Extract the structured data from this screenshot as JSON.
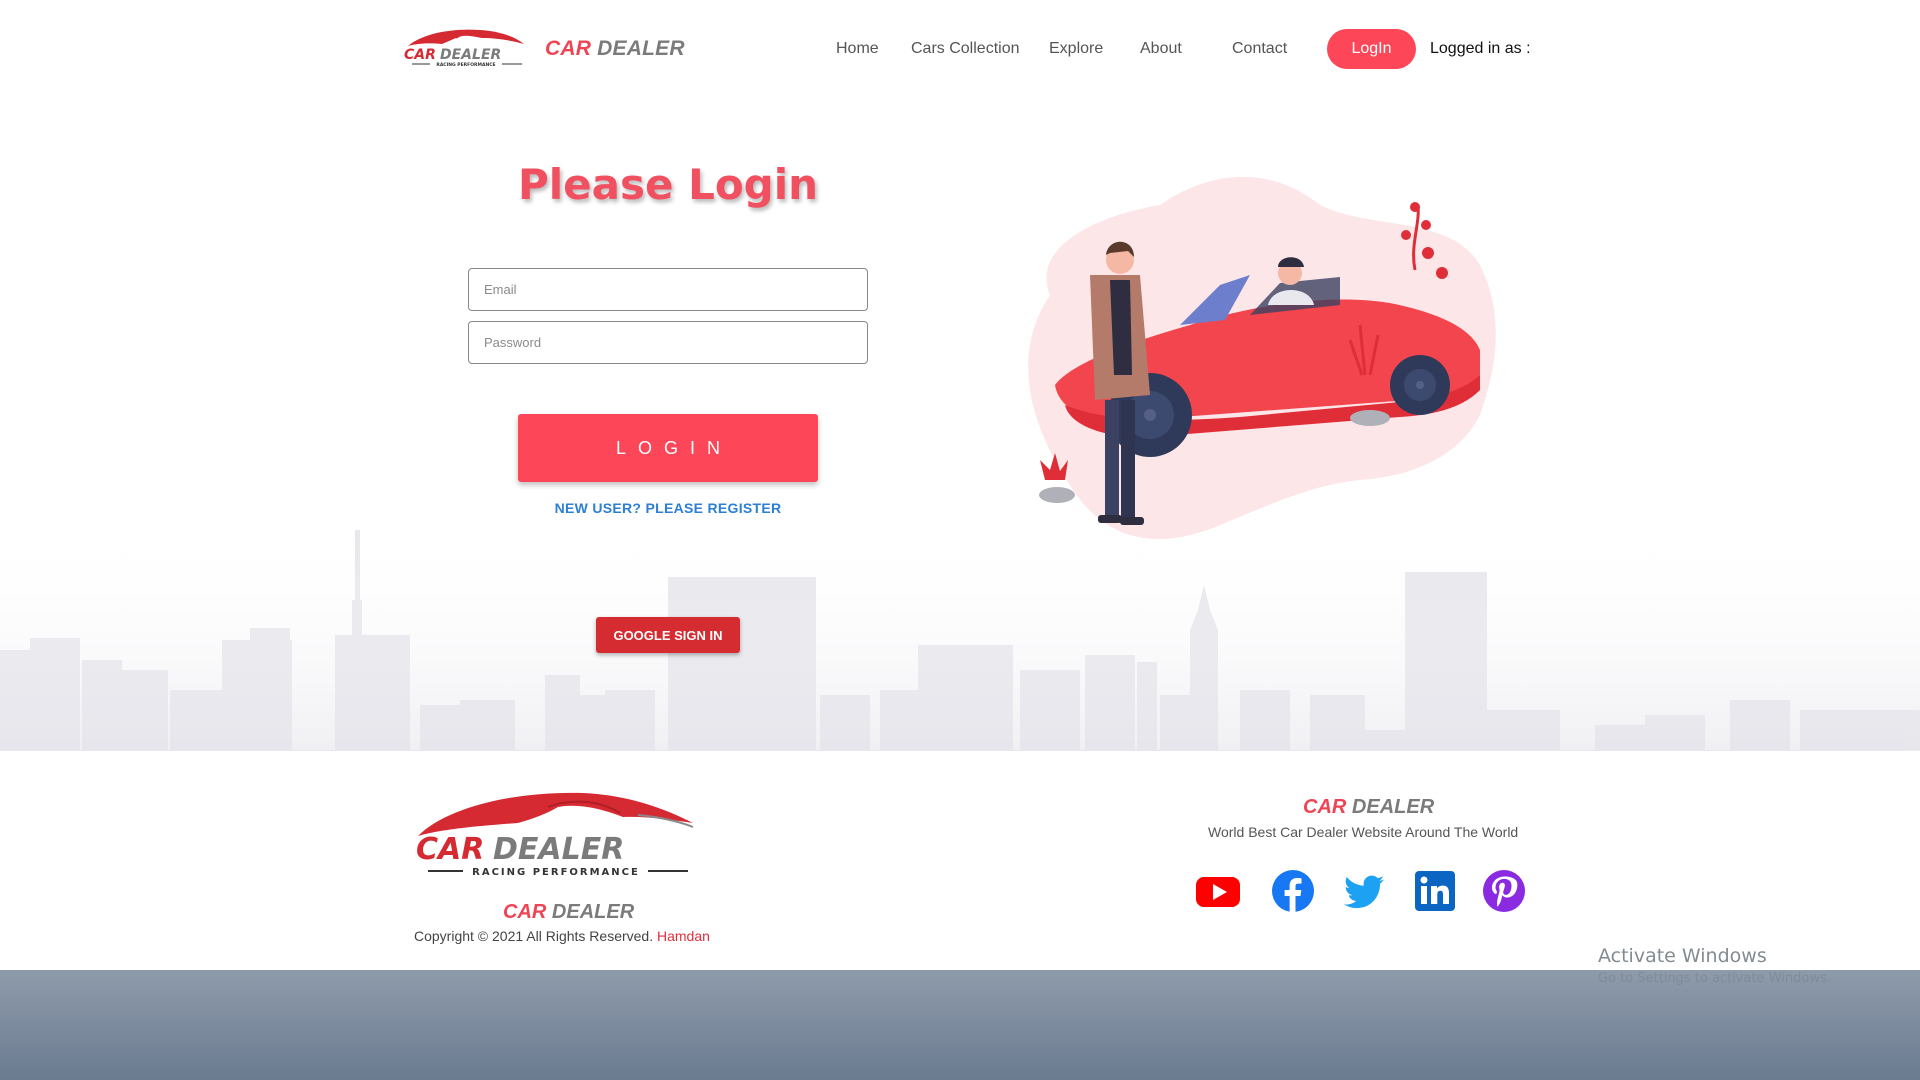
{
  "nav": {
    "brand_car": "CAR",
    "brand_dealer": "DEALER",
    "links": [
      "Home",
      "Cars Collection",
      "Explore",
      "About",
      "Contact"
    ],
    "login_button": "LogIn",
    "logged_in_as": "Logged in as :"
  },
  "logo": {
    "word_car": "CAR",
    "word_dealer": "DEALER",
    "subtitle": "RACING PERFORMANCE"
  },
  "login": {
    "title": "Please Login",
    "email_placeholder": "Email",
    "password_placeholder": "Password",
    "submit_label": "LOGIN",
    "register_link": "NEW USER? PLEASE REGISTER",
    "google_button": "GOOGLE SIGN IN"
  },
  "footer": {
    "brand_car": "CAR",
    "brand_dealer": "DEALER",
    "copyright": "Copyright © 2021 All Rights Reserved.",
    "author": "Hamdan",
    "tagline": "World Best Car Dealer Website Around The World",
    "social_icons": [
      "youtube-icon",
      "facebook-icon",
      "twitter-icon",
      "linkedin-icon",
      "pinterest-icon"
    ]
  },
  "watermark": {
    "title": "Activate Windows",
    "subtitle": "Go to Settings to activate Windows."
  },
  "colors": {
    "accent": "#fd4657",
    "brand_red": "#ee4555",
    "brand_gray": "#7b7b7b",
    "link_blue": "#2d7fd3",
    "google_red": "#d42c31",
    "youtube": "#ff0000",
    "facebook": "#1877f2",
    "twitter": "#1da1f2",
    "linkedin": "#0a66c2",
    "pinterest": "#8a2be2"
  }
}
